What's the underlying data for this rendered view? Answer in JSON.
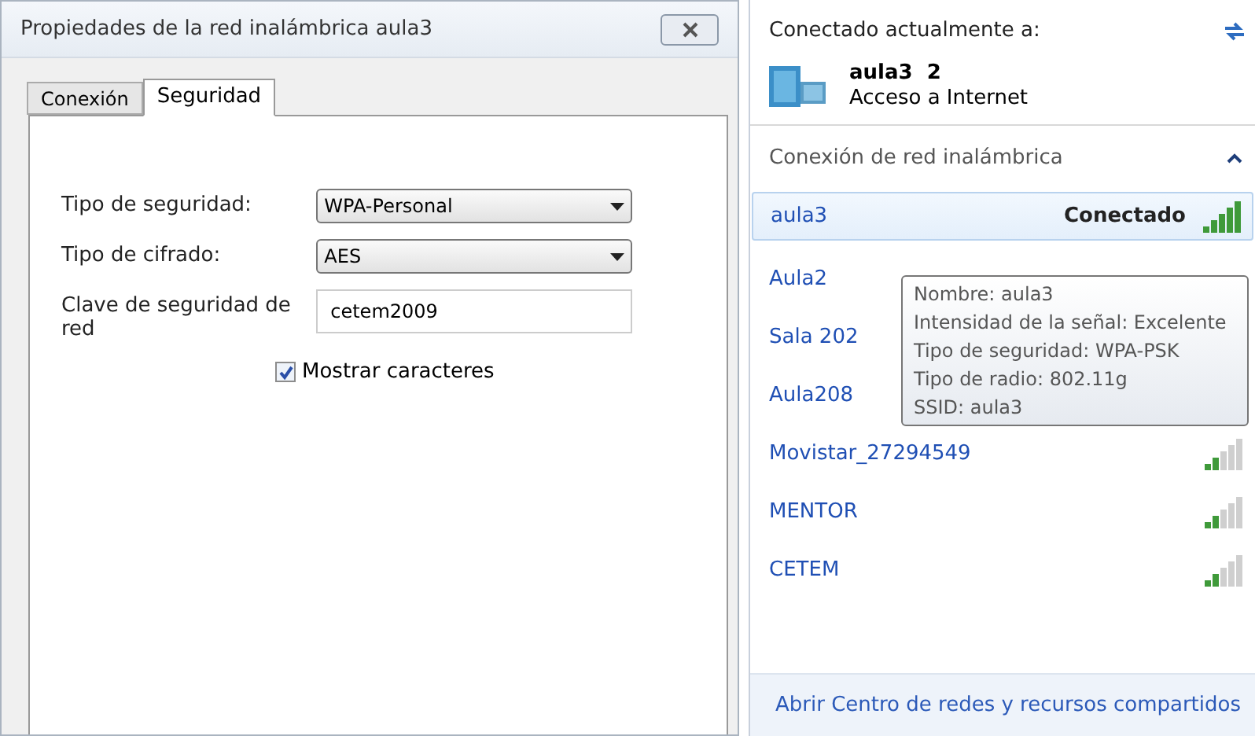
{
  "dialog": {
    "title": "Propiedades de la red inalámbrica aula3",
    "tabs": [
      {
        "label": "Conexión",
        "selected": false
      },
      {
        "label": "Seguridad",
        "selected": true
      }
    ],
    "fields": [
      {
        "kind": "select",
        "label": "Tipo de seguridad:",
        "value": "WPA-Personal"
      },
      {
        "kind": "select",
        "label": "Tipo de cifrado:",
        "value": "AES"
      },
      {
        "kind": "input",
        "label": "Clave de seguridad de red",
        "value": "cetem2009"
      }
    ],
    "checkbox": {
      "label": "Mostrar caracteres",
      "checked": true
    }
  },
  "network_panel": {
    "heading": "Conectado actualmente a:",
    "current": {
      "name": "aula3  2",
      "status": "Acceso a Internet"
    },
    "section": {
      "title": "Conexión de red inalámbrica",
      "expanded": true
    },
    "networks": [
      {
        "name": "aula3",
        "status": "Conectado",
        "selected": true,
        "signal_icon": true
      },
      {
        "name": "Aula2",
        "selected": false
      },
      {
        "name": "Sala 202",
        "selected": false
      },
      {
        "name": "Aula208",
        "selected": false
      },
      {
        "name": "Movistar_27294549",
        "selected": false,
        "signal_icon": true
      },
      {
        "name": "MENTOR",
        "selected": false,
        "signal_icon": true
      },
      {
        "name": "CETEM",
        "selected": false,
        "signal_icon": true
      }
    ],
    "tooltip": [
      "Nombre: aula3",
      "Intensidad de la señal: Excelente",
      "Tipo de seguridad: WPA-PSK",
      "Tipo de radio: 802.11g",
      "SSID: aula3"
    ],
    "footer_link": "Abrir Centro de redes y recursos compartidos"
  }
}
